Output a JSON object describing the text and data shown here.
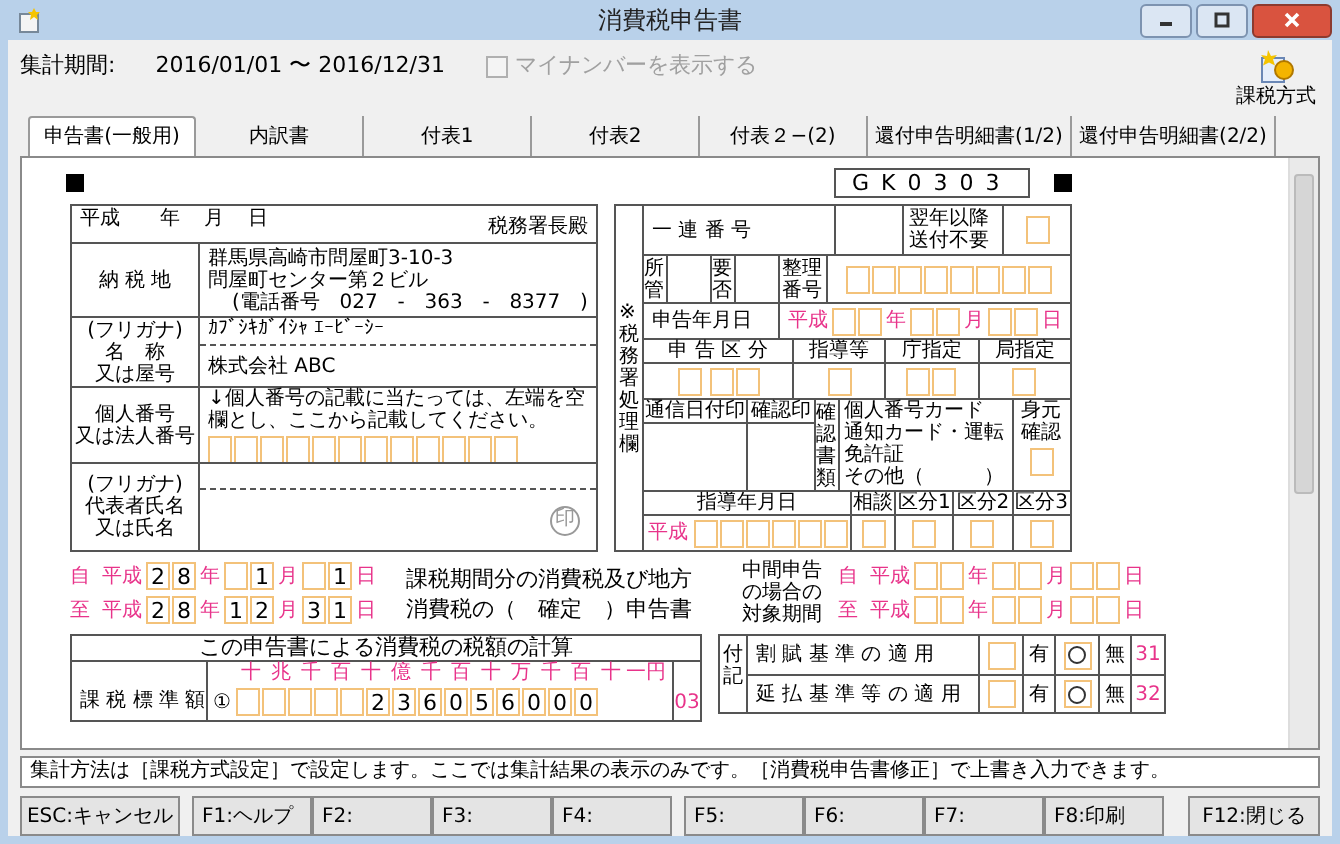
{
  "window": {
    "title": "消費税申告書"
  },
  "period": {
    "label": "集計期間:",
    "value": "2016/01/01 〜 2016/12/31"
  },
  "mynumber_checkbox": {
    "label": "マイナンバーを表示する",
    "checked": false,
    "disabled": true
  },
  "tax_method_button": {
    "label": "課税方式"
  },
  "tabs": [
    {
      "label": "申告書(一般用)",
      "selected": true
    },
    {
      "label": "内訳書",
      "selected": false
    },
    {
      "label": "付表1",
      "selected": false
    },
    {
      "label": "付表2",
      "selected": false
    },
    {
      "label": "付表２−(2)",
      "selected": false
    },
    {
      "label": "還付申告明細書(1/2)",
      "selected": false
    },
    {
      "label": "還付申告明細書(2/2)",
      "selected": false
    }
  ],
  "form": {
    "code": "GK0303",
    "header": {
      "era": "平成",
      "year": "年",
      "month": "月",
      "day": "日",
      "addressee": "税務署長殿"
    },
    "address": {
      "label": "納 税 地",
      "lines": [
        "群馬県高崎市問屋町3-10-3",
        "問屋町センター第２ビル"
      ],
      "phone": [
        "(電話番号",
        "027",
        "-",
        "363",
        "-",
        "8377",
        ")"
      ]
    },
    "name": {
      "labels": [
        "(フリガナ)",
        "名　称",
        "又は屋号"
      ],
      "furigana": "ｶﾌﾞｼｷｶﾞｲｼｬ ｴｰﾋﾞｰｼｰ",
      "value": "株式会社 ABC"
    },
    "number": {
      "labels": [
        "個人番号",
        "又は法人番号"
      ],
      "note": "↓個人番号の記載に当たっては、左端を空欄とし、ここから記載してください。"
    },
    "representative": {
      "labels": [
        "(フリガナ)",
        "代表者氏名",
        "又は氏名"
      ],
      "seal": "印"
    },
    "office": {
      "side_label": "※税務署処理欄",
      "serial": "一 連 番 号",
      "no_send": "翌年以降送付不要",
      "jurisdiction": "所管",
      "necessity": "要否",
      "ref_no": "整理番号",
      "filing_date": "申告年月日",
      "date_parts": [
        "平成",
        "年",
        "月",
        "日"
      ],
      "headers": [
        "申 告 区 分",
        "指導等",
        "庁指定",
        "局指定"
      ],
      "stamp": "通信日付印",
      "confirm": "確認印",
      "docs": "確認書類",
      "doc_items": [
        "個人番号カード",
        "通知カード・運転免許証",
        "その他（　　　）"
      ],
      "identity": "身元確認",
      "guidance_headers": [
        "指導年月日",
        "相談",
        "区分1",
        "区分2",
        "区分3"
      ],
      "guidance_era": "平成"
    },
    "periods": [
      {
        "prefix": "自",
        "era": "平成",
        "year": [
          "2",
          "8"
        ],
        "year_unit": "年",
        "month": [
          "1"
        ],
        "month_unit": "月",
        "day": [
          "1"
        ],
        "day_unit": "日"
      },
      {
        "prefix": "至",
        "era": "平成",
        "year": [
          "2",
          "8"
        ],
        "year_unit": "年",
        "month": [
          "1",
          "2"
        ],
        "month_unit": "月",
        "day": [
          "3",
          "1"
        ],
        "day_unit": "日"
      }
    ],
    "return_title": [
      "課税期間分の消費税及び地方",
      "消費税の（　確定　）申告書"
    ],
    "interim": {
      "labels": [
        "中間申告",
        "の場合の",
        "対象期間"
      ],
      "periods": [
        {
          "prefix": "自",
          "era": "平成",
          "year_unit": "年",
          "month_unit": "月",
          "day_unit": "日"
        },
        {
          "prefix": "至",
          "era": "平成",
          "year_unit": "年",
          "month_unit": "月",
          "day_unit": "日"
        }
      ]
    },
    "calculation": {
      "title": "この申告書による消費税の税額の計算",
      "place_headers": [
        "十",
        "兆",
        "千",
        "百",
        "十",
        "億",
        "千",
        "百",
        "十",
        "万",
        "千",
        "百",
        "十",
        "一円"
      ],
      "rows": [
        {
          "label": "課 税 標 準 額",
          "number": "①",
          "digits": [
            "2",
            "3",
            "6",
            "0",
            "5",
            "6",
            "0",
            "0",
            "0"
          ],
          "code": "03"
        }
      ]
    },
    "notes": {
      "side_label": "付記",
      "rows": [
        {
          "label": "割 賦 基 準 の 適 用",
          "yes": "有",
          "no": "無",
          "code": "31",
          "applied": false
        },
        {
          "label": "延 払 基 準 等 の 適 用",
          "yes": "有",
          "no": "無",
          "code": "32",
          "applied": false
        }
      ]
    }
  },
  "status_message": "集計方法は［課税方式設定］で設定します。ここでは集計結果の表示のみです。［消費税申告書修正］で上書き入力できます。",
  "function_keys": [
    [
      "ESC:キャンセル"
    ],
    [
      "F1:ヘルプ",
      "F2:",
      "F3:",
      "F4:"
    ],
    [
      "F5:",
      "F6:",
      "F7:",
      "F8:印刷"
    ],
    [
      "F12:閉じる"
    ]
  ]
}
